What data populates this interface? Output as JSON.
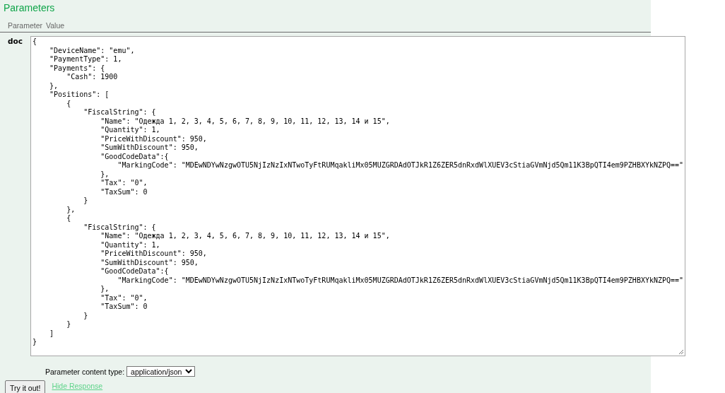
{
  "section": {
    "title": "Parameters"
  },
  "table": {
    "columns": [
      "Parameter",
      "Value"
    ],
    "rows": [
      {
        "parameter": "doc",
        "value": "{\n    \"DeviceName\": \"emu\",\n    \"PaymentType\": 1,\n    \"Payments\": {\n        \"Cash\": 1900\n    },\n    \"Positions\": [\n        {\n            \"FiscalString\": {\n                \"Name\": \"Одежда 1, 2, 3, 4, 5, 6, 7, 8, 9, 10, 11, 12, 13, 14 и 15\",\n                \"Quantity\": 1,\n                \"PriceWithDiscount\": 950,\n                \"SumWithDiscount\": 950,\n                \"GoodCodeData\":{\n                    \"MarkingCode\": \"MDEwNDYwNzgwOTU5NjIzNzIxNTwoTyFtRUMqakliMx05MUZGRDAdOTJkR1Z6ZER5dnRxdWlXUEV3cStiaGVmNjd5Qm11K3BpQTI4em9PZHBXYkNZPQ==\"\n                },\n                \"Tax\": \"0\",\n                \"TaxSum\": 0\n            }\n        },\n        {\n            \"FiscalString\": {\n                \"Name\": \"Одежда 1, 2, 3, 4, 5, 6, 7, 8, 9, 10, 11, 12, 13, 14 и 15\",\n                \"Quantity\": 1,\n                \"PriceWithDiscount\": 950,\n                \"SumWithDiscount\": 950,\n                \"GoodCodeData\":{\n                    \"MarkingCode\": \"MDEwNDYwNzgwOTU5NjIzNzIxNTwoTyFtRUMqakliMx05MUZGRDAdOTJkR1Z6ZER5dnRxdWlXUEV3cStiaGVmNjd5Qm11K3BpQTI4em9PZHBXYkNZPQ==\"\n                },\n                \"Tax\": \"0\",\n                \"TaxSum\": 0\n            }\n        }\n    ]\n}",
        "content_type_label": "Parameter content type:",
        "content_type": "application/json"
      }
    ]
  },
  "actions": {
    "try_button": "Try it out!",
    "hide_link": "Hide Response"
  }
}
